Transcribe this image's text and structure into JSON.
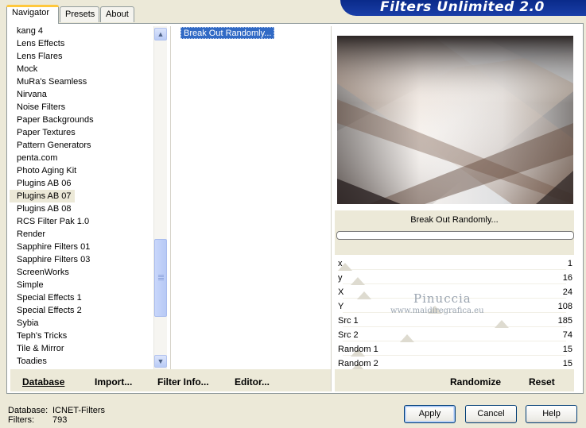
{
  "window": {
    "title": "Filters Unlimited 2.0"
  },
  "tabs": [
    {
      "label": "Navigator",
      "active": true
    },
    {
      "label": "Presets",
      "active": false
    },
    {
      "label": "About",
      "active": false
    }
  ],
  "categories": {
    "items": [
      "kang 4",
      "Lens Effects",
      "Lens Flares",
      "Mock",
      "MuRa's Seamless",
      "Nirvana",
      "Noise Filters",
      "Paper Backgrounds",
      "Paper Textures",
      "Pattern Generators",
      "penta.com",
      "Photo Aging Kit",
      "Plugins AB 06",
      "Plugins AB 07",
      "Plugins AB 08",
      "RCS Filter Pak 1.0",
      "Render",
      "Sapphire Filters 01",
      "Sapphire Filters 03",
      "ScreenWorks",
      "Simple",
      "Special Effects 1",
      "Special Effects 2",
      "Sybia",
      "Teph's Tricks",
      "Tile & Mirror",
      "Toadies"
    ],
    "selected_index": 13
  },
  "filters": {
    "items": [
      "Break Out Randomly..."
    ],
    "selected": "Break Out Randomly..."
  },
  "preview": {
    "filter_name": "Break Out Randomly..."
  },
  "parameters": [
    {
      "name": "x",
      "value": "1",
      "level": 0.0
    },
    {
      "name": "y",
      "value": "16",
      "level": 0.06
    },
    {
      "name": "X",
      "value": "24",
      "level": 0.09
    },
    {
      "name": "Y",
      "value": "108",
      "level": 0.42
    },
    {
      "name": "Src 1",
      "value": "185",
      "level": 0.73
    },
    {
      "name": "Src 2",
      "value": "74",
      "level": 0.29
    },
    {
      "name": "Random 1",
      "value": "15",
      "level": 0.06
    },
    {
      "name": "Random 2",
      "value": "15",
      "level": 0.06
    }
  ],
  "left_buttons": {
    "database": "Database",
    "import": "Import...",
    "filter_info": "Filter Info...",
    "editor": "Editor..."
  },
  "right_buttons": {
    "randomize": "Randomize",
    "reset": "Reset"
  },
  "footer": {
    "database_label": "Database:",
    "database_value": "ICNET-Filters",
    "filters_label": "Filters:",
    "filters_value": "793"
  },
  "dialog_buttons": {
    "apply": "Apply",
    "cancel": "Cancel",
    "help": "Help"
  },
  "watermark": {
    "name": "Pinuccia",
    "site": "www.maidiregrafica.eu"
  },
  "colors": {
    "selection": "#316ac5",
    "banner": "#0a2a8a",
    "dialog_bg": "#ece9d8"
  }
}
